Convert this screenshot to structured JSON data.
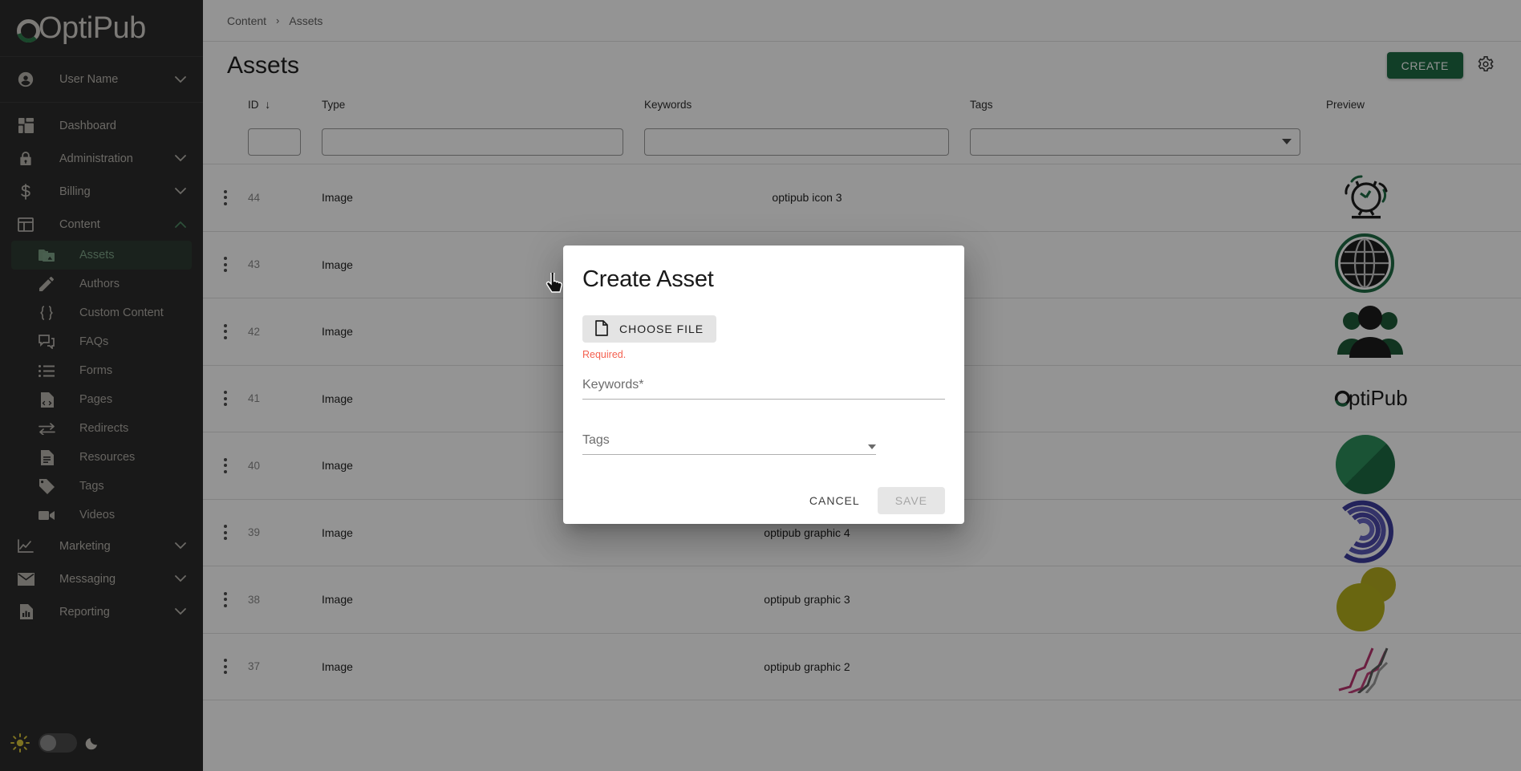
{
  "brand": {
    "name": "OptiPub",
    "accent": "#1e6b44",
    "sidebar_bg": "#2b2b2b"
  },
  "sidebar": {
    "user": {
      "label": "User Name",
      "icon": "account-circle-icon"
    },
    "items": [
      {
        "label": "Dashboard",
        "icon": "dashboard-icon",
        "expandable": false
      },
      {
        "label": "Administration",
        "icon": "lock-icon",
        "expandable": true
      },
      {
        "label": "Billing",
        "icon": "dollar-icon",
        "expandable": true
      },
      {
        "label": "Content",
        "icon": "content-layout-icon",
        "expandable": true,
        "expanded": true
      },
      {
        "label": "Marketing",
        "icon": "line-chart-icon",
        "expandable": true
      },
      {
        "label": "Messaging",
        "icon": "envelope-icon",
        "expandable": true
      },
      {
        "label": "Reporting",
        "icon": "report-bar-icon",
        "expandable": true
      }
    ],
    "content_children": [
      {
        "label": "Assets",
        "icon": "image-folder-icon",
        "active": true
      },
      {
        "label": "Authors",
        "icon": "pencil-icon",
        "active": false
      },
      {
        "label": "Custom Content",
        "icon": "braces-icon",
        "active": false
      },
      {
        "label": "FAQs",
        "icon": "faq-bubble-icon",
        "active": false
      },
      {
        "label": "Forms",
        "icon": "list-icon",
        "active": false
      },
      {
        "label": "Pages",
        "icon": "code-file-icon",
        "active": false
      },
      {
        "label": "Redirects",
        "icon": "redirect-arrows-icon",
        "active": false
      },
      {
        "label": "Resources",
        "icon": "document-icon",
        "active": false
      },
      {
        "label": "Tags",
        "icon": "tag-icon",
        "active": false
      },
      {
        "label": "Videos",
        "icon": "video-camera-icon",
        "active": false
      }
    ],
    "theme_toggle": {
      "light_icon": "sun-icon",
      "dark_icon": "moon-icon",
      "state": "light"
    }
  },
  "breadcrumb": {
    "parent": "Content",
    "separator": "›",
    "current": "Assets"
  },
  "header": {
    "title": "Assets",
    "create_label": "CREATE",
    "settings_icon": "gear-icon"
  },
  "table": {
    "columns": [
      "ID",
      "Type",
      "Keywords",
      "Tags",
      "Preview"
    ],
    "sort": {
      "column": "ID",
      "direction": "desc",
      "glyph": "↓"
    },
    "filters": {
      "id": {
        "value": "",
        "placeholder": ""
      },
      "type": {
        "value": "",
        "placeholder": ""
      },
      "keywords": {
        "value": "",
        "placeholder": ""
      },
      "tags": {
        "value": "",
        "placeholder": ""
      }
    },
    "rows": [
      {
        "id": "44",
        "type": "Image",
        "keywords": "optipub icon 3",
        "tags": "",
        "preview": "alarm-clock-graphic"
      },
      {
        "id": "43",
        "type": "Image",
        "keywords": "",
        "tags": "",
        "preview": "globe-graphic"
      },
      {
        "id": "42",
        "type": "Image",
        "keywords": "",
        "tags": "",
        "preview": "people-group-graphic"
      },
      {
        "id": "41",
        "type": "Image",
        "keywords": "",
        "tags": "",
        "preview": "optipub-wordmark-graphic"
      },
      {
        "id": "40",
        "type": "Image",
        "keywords": "",
        "tags": "",
        "preview": "green-circle-graphic"
      },
      {
        "id": "39",
        "type": "Image",
        "keywords": "optipub graphic 4",
        "tags": "",
        "preview": "purple-arcs-graphic"
      },
      {
        "id": "38",
        "type": "Image",
        "keywords": "optipub graphic 3",
        "tags": "",
        "preview": "yellow-circles-graphic"
      },
      {
        "id": "37",
        "type": "Image",
        "keywords": "optipub graphic 2",
        "tags": "",
        "preview": "pink-lines-graphic"
      }
    ]
  },
  "modal": {
    "title": "Create Asset",
    "choose_file_label": "CHOOSE FILE",
    "choose_file_icon": "file-icon",
    "file_error": "Required.",
    "keywords_label": "Keywords*",
    "keywords_value": "",
    "tags_label": "Tags",
    "tags_value": "",
    "cancel_label": "CANCEL",
    "save_label": "SAVE",
    "save_disabled": true
  }
}
